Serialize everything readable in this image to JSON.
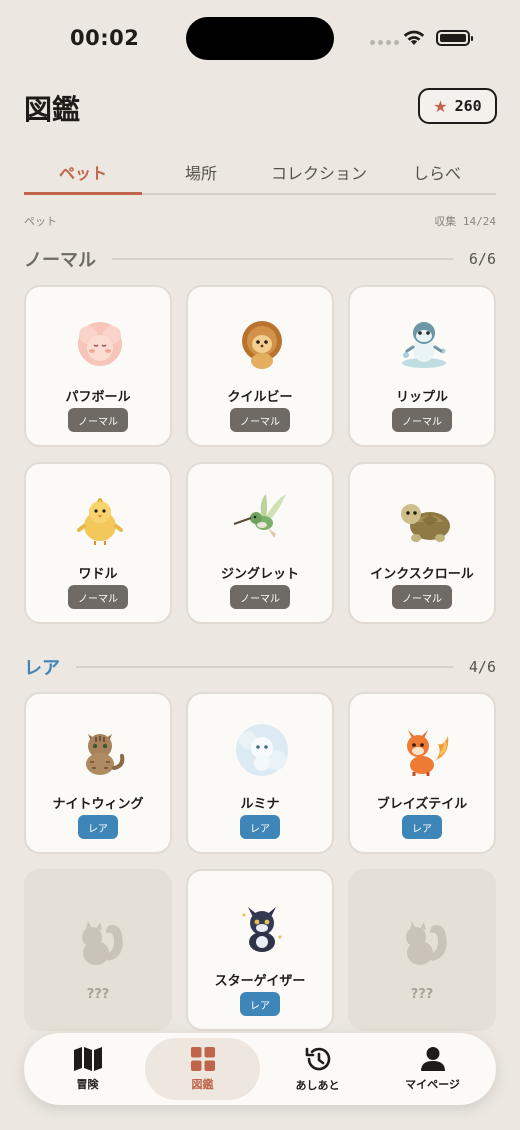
{
  "status_bar": {
    "time": "00:02"
  },
  "header": {
    "title": "図鑑",
    "stars": "260"
  },
  "tabs": [
    {
      "label": "ペット",
      "active": true
    },
    {
      "label": "場所",
      "active": false
    },
    {
      "label": "コレクション",
      "active": false
    },
    {
      "label": "しらべ",
      "active": false
    }
  ],
  "subheader": {
    "category": "ペット",
    "collected": "収集 14/24"
  },
  "sections": {
    "normal": {
      "name": "ノーマル",
      "count": "6/6",
      "pets": [
        {
          "name": "パフボール",
          "rarity": "ノーマル",
          "icon": "pink-puffball-icon"
        },
        {
          "name": "クイルビー",
          "rarity": "ノーマル",
          "icon": "hedgehog-icon"
        },
        {
          "name": "リップル",
          "rarity": "ノーマル",
          "icon": "water-seal-icon"
        },
        {
          "name": "ワドル",
          "rarity": "ノーマル",
          "icon": "chick-icon"
        },
        {
          "name": "ジングレット",
          "rarity": "ノーマル",
          "icon": "hummingbird-icon"
        },
        {
          "name": "インクスクロール",
          "rarity": "ノーマル",
          "icon": "turtle-icon"
        }
      ]
    },
    "rare": {
      "name": "レア",
      "count": "4/6",
      "pets": [
        {
          "name": "ナイトウィング",
          "rarity": "レア",
          "icon": "tabby-cat-icon"
        },
        {
          "name": "ルミナ",
          "rarity": "レア",
          "icon": "mist-spirit-icon"
        },
        {
          "name": "ブレイズテイル",
          "rarity": "レア",
          "icon": "fire-fox-icon"
        },
        {
          "name": "???",
          "rarity": "",
          "icon": "locked-squirrel-silhouette-icon"
        },
        {
          "name": "スターゲイザー",
          "rarity": "レア",
          "icon": "star-wolf-pup-icon"
        },
        {
          "name": "???",
          "rarity": "",
          "icon": "locked-squirrel-silhouette-icon"
        }
      ]
    }
  },
  "bottom_nav": [
    {
      "label": "冒険",
      "icon": "map-icon",
      "active": false
    },
    {
      "label": "図鑑",
      "icon": "grid-icon",
      "active": true
    },
    {
      "label": "あしあと",
      "icon": "history-icon",
      "active": false
    },
    {
      "label": "マイページ",
      "icon": "person-icon",
      "active": false
    }
  ],
  "colors": {
    "accent": "#C0644A",
    "rare": "#3E86B8",
    "normal_tag": "#6F6A64",
    "background": "#ECE8E1"
  }
}
